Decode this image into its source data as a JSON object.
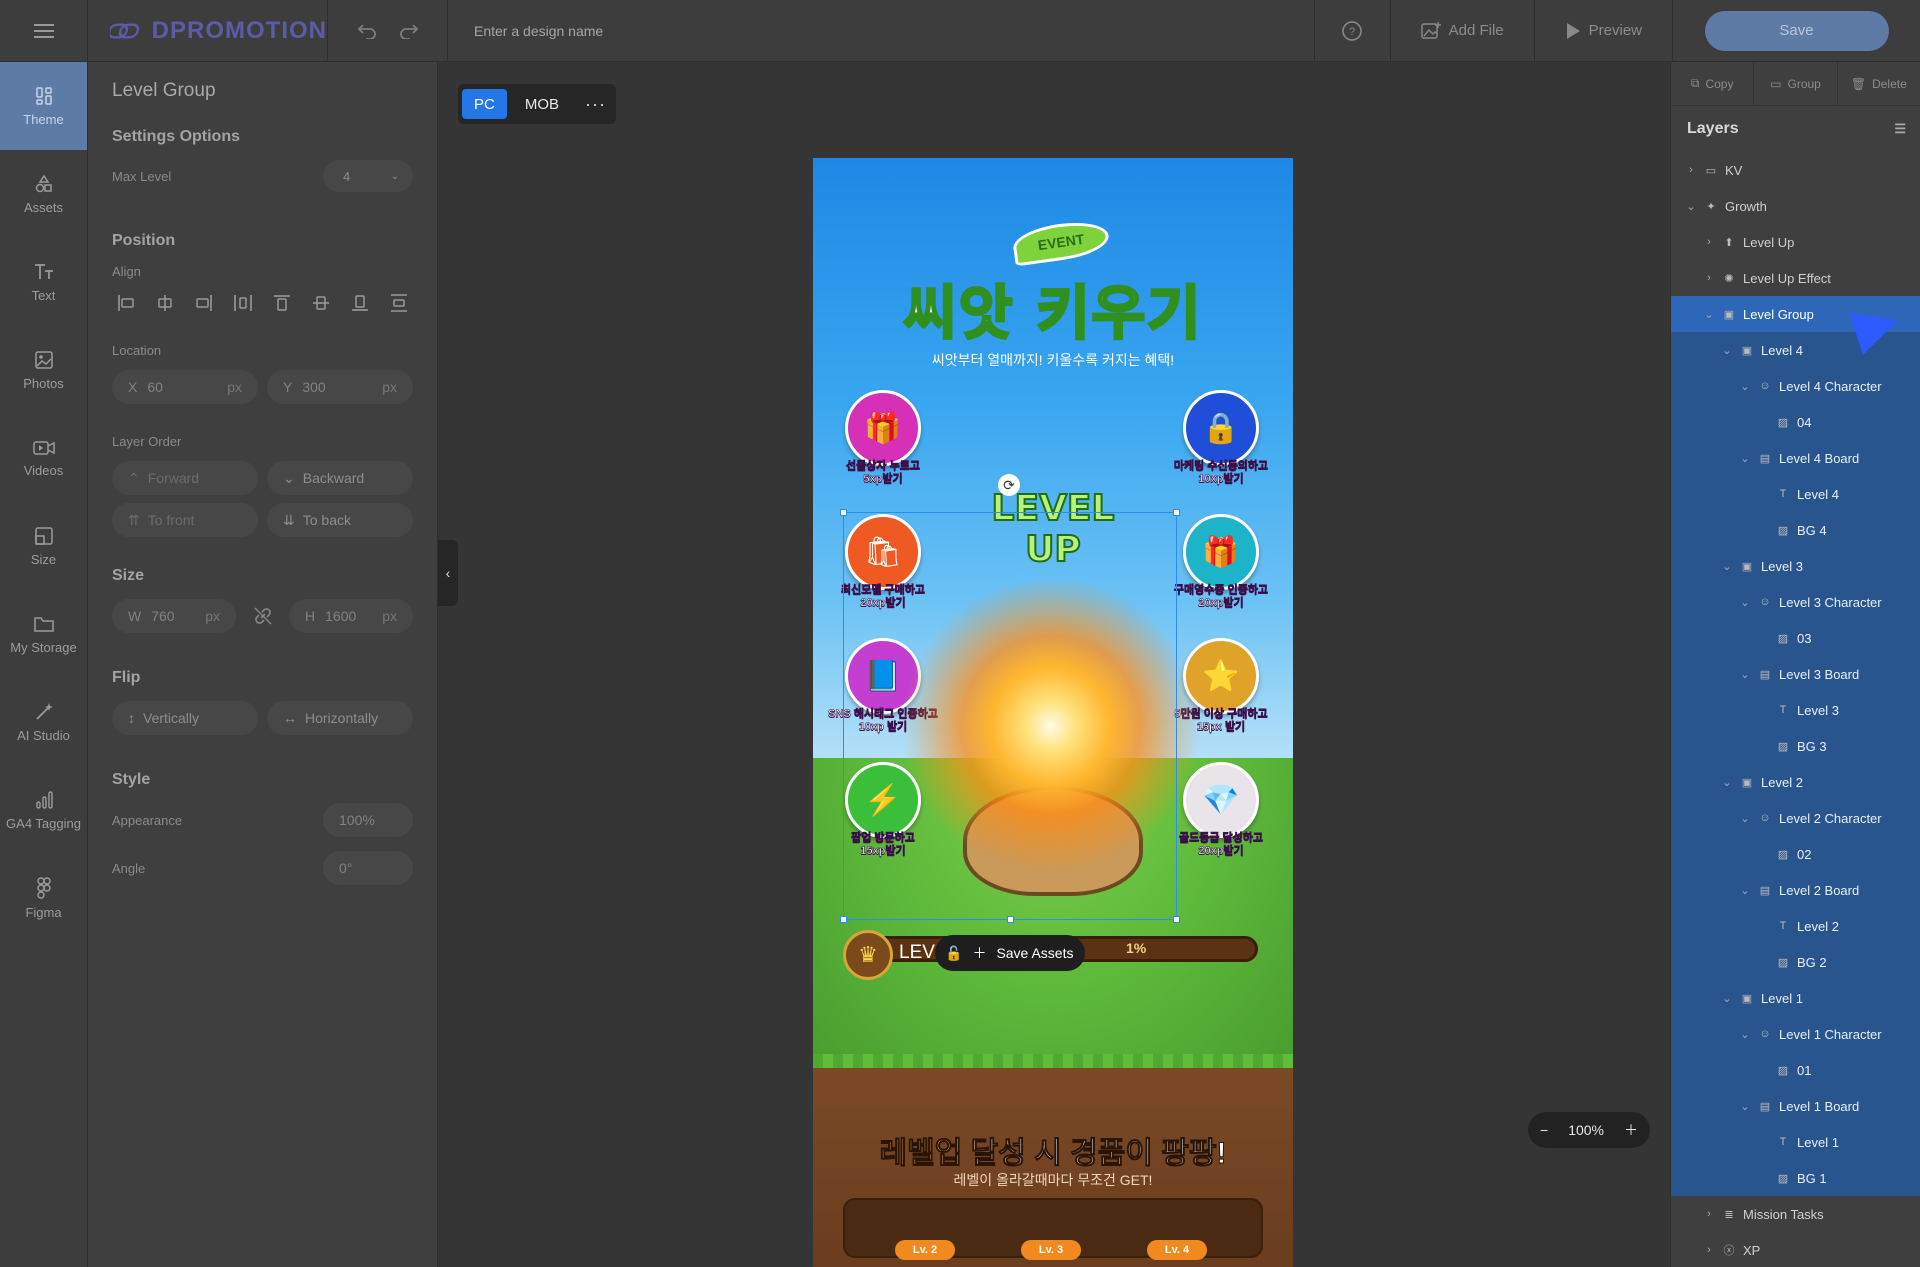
{
  "topbar": {
    "brand": "DPROMOTION",
    "design_name_placeholder": "Enter a design name",
    "help_label": "?",
    "add_file": "Add File",
    "preview": "Preview",
    "save": "Save"
  },
  "leftnav": [
    {
      "label": "Theme",
      "icon": "theme-icon"
    },
    {
      "label": "Assets",
      "icon": "assets-icon"
    },
    {
      "label": "Text",
      "icon": "text-icon"
    },
    {
      "label": "Photos",
      "icon": "photos-icon"
    },
    {
      "label": "Videos",
      "icon": "videos-icon"
    },
    {
      "label": "Size",
      "icon": "size-icon"
    },
    {
      "label": "My Storage",
      "icon": "storage-icon"
    },
    {
      "label": "AI Studio",
      "icon": "ai-studio-icon"
    },
    {
      "label": "GA4 Tagging",
      "icon": "ga4-icon"
    },
    {
      "label": "Figma",
      "icon": "figma-icon"
    }
  ],
  "panel": {
    "title": "Level Group",
    "settings_options": "Settings Options",
    "max_level_label": "Max Level",
    "max_level_value": "4",
    "position": "Position",
    "align": "Align",
    "location": "Location",
    "x_label": "X",
    "x_value": "60",
    "y_label": "Y",
    "y_value": "300",
    "unit": "px",
    "layer_order": "Layer Order",
    "forward": "Forward",
    "backward": "Backward",
    "to_front": "To front",
    "to_back": "To back",
    "size": "Size",
    "w_label": "W",
    "w_value": "760",
    "h_label": "H",
    "h_value": "1600",
    "flip": "Flip",
    "vertically": "Vertically",
    "horizontally": "Horizontally",
    "style": "Style",
    "appearance_label": "Appearance",
    "appearance_value": "100%",
    "angle_label": "Angle",
    "angle_value": "0°"
  },
  "canvas": {
    "device_pc": "PC",
    "device_mob": "MOB",
    "more": "···",
    "zoom": "100%",
    "design": {
      "event": "EVENT",
      "title": "씨앗 키우기",
      "subtitle": "씨앗부터 열매까지! 키울수록 커지는 혜택!",
      "missions": [
        {
          "line1": "선물상자 누르고",
          "line2": "5xp받기",
          "color": "#d62fb8",
          "glyph": "🎁"
        },
        {
          "line1": "마케팅 수신동의하고",
          "line2": "10xp받기",
          "color": "#1f4fd8",
          "glyph": "🔒"
        },
        {
          "line1": "최신모델 구매하고",
          "line2": "20xp받기",
          "color": "#ef5a22",
          "glyph": "🛍"
        },
        {
          "line1": "구매영수증 인증하고",
          "line2": "20xp받기",
          "color": "#1db3c9",
          "glyph": "🎁"
        },
        {
          "line1": "SNS 해시태그 인증하고",
          "line2": "10xp 받기",
          "color": "#c43fd1",
          "glyph": "📘"
        },
        {
          "line1": "5만원 이상 구매하고",
          "line2": "15px 받기",
          "color": "#e0a32a",
          "glyph": "⭐"
        },
        {
          "line1": "팝업 방문하고",
          "line2": "15xp받기",
          "color": "#3bbf3b",
          "glyph": "⚡"
        },
        {
          "line1": "골드등급 달성하고",
          "line2": "20xp받기",
          "color": "#e9e4ea",
          "glyph": "💎"
        }
      ],
      "level_up": "LEVEL UP",
      "level_label": "LEV",
      "progress_percent": "1%",
      "save_assets": "Save Assets",
      "reward_highlight": "레벨업",
      "reward_rest": " 달성 시 경품이 팡팡!",
      "reward_sub": "레벨이 올라갈때마다 무조건 GET!",
      "level_tags": [
        "Lv. 2",
        "Lv. 3",
        "Lv. 4"
      ]
    }
  },
  "rightpanel": {
    "copy": "Copy",
    "group": "Group",
    "delete": "Delete",
    "layers_title": "Layers",
    "layers": [
      {
        "label": "KV",
        "depth": 0,
        "chev": "›",
        "icon": "folder-icon",
        "state": ""
      },
      {
        "label": "Growth",
        "depth": 0,
        "chev": "⌄",
        "icon": "sparkle-icon",
        "state": ""
      },
      {
        "label": "Level Up",
        "depth": 1,
        "chev": "›",
        "icon": "arrow-up-icon",
        "state": ""
      },
      {
        "label": "Level Up Effect",
        "depth": 1,
        "chev": "›",
        "icon": "effect-icon",
        "state": ""
      },
      {
        "label": "Level Group",
        "depth": 1,
        "chev": "⌄",
        "icon": "group-icon",
        "state": "sel"
      },
      {
        "label": "Level 4",
        "depth": 2,
        "chev": "⌄",
        "icon": "group-icon",
        "state": "child"
      },
      {
        "label": "Level 4 Character",
        "depth": 3,
        "chev": "⌄",
        "icon": "character-icon",
        "state": "child"
      },
      {
        "label": "04",
        "depth": 4,
        "chev": "",
        "icon": "image-icon",
        "state": "child"
      },
      {
        "label": "Level 4 Board",
        "depth": 3,
        "chev": "⌄",
        "icon": "board-icon",
        "state": "child"
      },
      {
        "label": "Level 4",
        "depth": 4,
        "chev": "",
        "icon": "text-icon",
        "state": "child"
      },
      {
        "label": "BG 4",
        "depth": 4,
        "chev": "",
        "icon": "image-icon",
        "state": "child"
      },
      {
        "label": "Level 3",
        "depth": 2,
        "chev": "⌄",
        "icon": "group-icon",
        "state": "child"
      },
      {
        "label": "Level 3 Character",
        "depth": 3,
        "chev": "⌄",
        "icon": "character-icon",
        "state": "child"
      },
      {
        "label": "03",
        "depth": 4,
        "chev": "",
        "icon": "image-icon",
        "state": "child"
      },
      {
        "label": "Level 3 Board",
        "depth": 3,
        "chev": "⌄",
        "icon": "board-icon",
        "state": "child"
      },
      {
        "label": "Level 3",
        "depth": 4,
        "chev": "",
        "icon": "text-icon",
        "state": "child"
      },
      {
        "label": "BG 3",
        "depth": 4,
        "chev": "",
        "icon": "image-icon",
        "state": "child"
      },
      {
        "label": "Level 2",
        "depth": 2,
        "chev": "⌄",
        "icon": "group-icon",
        "state": "child"
      },
      {
        "label": "Level 2 Character",
        "depth": 3,
        "chev": "⌄",
        "icon": "character-icon",
        "state": "child"
      },
      {
        "label": "02",
        "depth": 4,
        "chev": "",
        "icon": "image-icon",
        "state": "child"
      },
      {
        "label": "Level 2 Board",
        "depth": 3,
        "chev": "⌄",
        "icon": "board-icon",
        "state": "child"
      },
      {
        "label": "Level 2",
        "depth": 4,
        "chev": "",
        "icon": "text-icon",
        "state": "child"
      },
      {
        "label": "BG 2",
        "depth": 4,
        "chev": "",
        "icon": "image-icon",
        "state": "child"
      },
      {
        "label": "Level 1",
        "depth": 2,
        "chev": "⌄",
        "icon": "group-icon",
        "state": "child"
      },
      {
        "label": "Level 1 Character",
        "depth": 3,
        "chev": "⌄",
        "icon": "character-icon",
        "state": "child"
      },
      {
        "label": "01",
        "depth": 4,
        "chev": "",
        "icon": "image-icon",
        "state": "child"
      },
      {
        "label": "Level 1 Board",
        "depth": 3,
        "chev": "⌄",
        "icon": "board-icon",
        "state": "child"
      },
      {
        "label": "Level 1",
        "depth": 4,
        "chev": "",
        "icon": "text-icon",
        "state": "child"
      },
      {
        "label": "BG 1",
        "depth": 4,
        "chev": "",
        "icon": "image-icon",
        "state": "child"
      },
      {
        "label": "Mission Tasks",
        "depth": 1,
        "chev": "›",
        "icon": "list-icon",
        "state": ""
      },
      {
        "label": "XP",
        "depth": 1,
        "chev": "›",
        "icon": "xp-icon",
        "state": ""
      }
    ]
  }
}
